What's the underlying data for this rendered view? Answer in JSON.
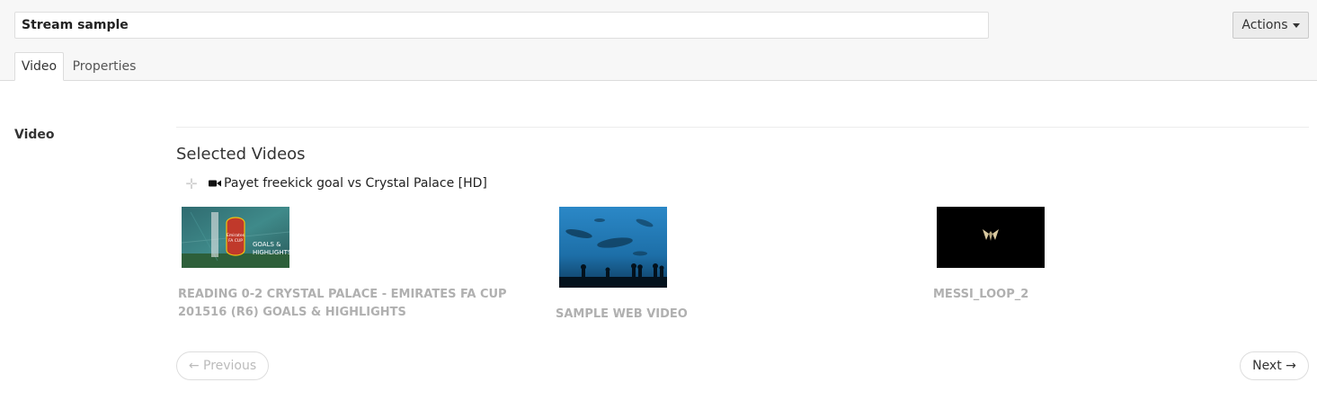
{
  "header": {
    "title_value": "Stream sample",
    "actions_label": "Actions"
  },
  "tabs": [
    {
      "label": "Video",
      "active": true
    },
    {
      "label": "Properties",
      "active": false
    }
  ],
  "video_section": {
    "label": "Video",
    "selected_title": "Selected Videos",
    "selected_items": [
      {
        "title": "Payet freekick goal vs Crystal Palace [HD]",
        "icon": "video-camera-icon"
      }
    ]
  },
  "library": {
    "cards": [
      {
        "title": "READING 0-2 CRYSTAL PALACE - EMIRATES FA CUP 201516 (R6) GOALS & HIGHLIGHTS",
        "thumb_text_1": "GOALS &",
        "thumb_text_2": "HIGHLIGHTS",
        "thumb_badge_1": "Emirates",
        "thumb_badge_2": "FA CUP"
      },
      {
        "title": "SAMPLE WEB VIDEO"
      },
      {
        "title": "MESSI_LOOP_2"
      }
    ]
  },
  "pager": {
    "previous_label": "← Previous",
    "next_label": "Next →"
  },
  "colors": {
    "header_bg": "#f7f7f7",
    "muted_label": "#b0b0b0",
    "border": "#dcdcdc"
  }
}
